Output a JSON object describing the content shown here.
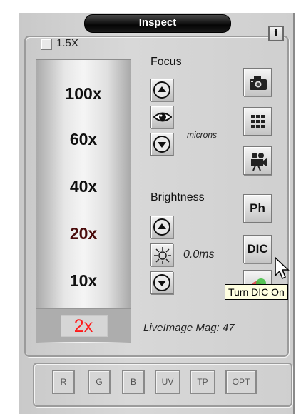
{
  "window": {
    "title": "Inspect"
  },
  "toggle_15x": {
    "label": "1.5X",
    "checked": false
  },
  "info_button": {
    "label": "i"
  },
  "magnifications": [
    "100x",
    "60x",
    "40x",
    "20x",
    "10x",
    "2x"
  ],
  "selected_magnification": "2x",
  "focus": {
    "label": "Focus",
    "units": "microns"
  },
  "brightness": {
    "label": "Brightness",
    "exposure": "0.0ms"
  },
  "side_buttons": {
    "ph": "Ph",
    "dic": "DIC"
  },
  "tooltip": {
    "text": "Turn DIC On"
  },
  "live_image_mag": "LiveImage Mag: 47",
  "channels": [
    "R",
    "G",
    "B",
    "UV",
    "TP",
    "OPT"
  ],
  "colors": {
    "selected_mag": "#ff1a1a",
    "title_bar": "#000000",
    "tooltip_bg": "#ffffe1"
  },
  "icons": [
    "camera-icon",
    "grid-icon",
    "movie-camera-icon",
    "eye-icon",
    "brightness-sun-icon",
    "up-arrow-icon",
    "down-arrow-icon",
    "mouse-pointer-icon"
  ]
}
